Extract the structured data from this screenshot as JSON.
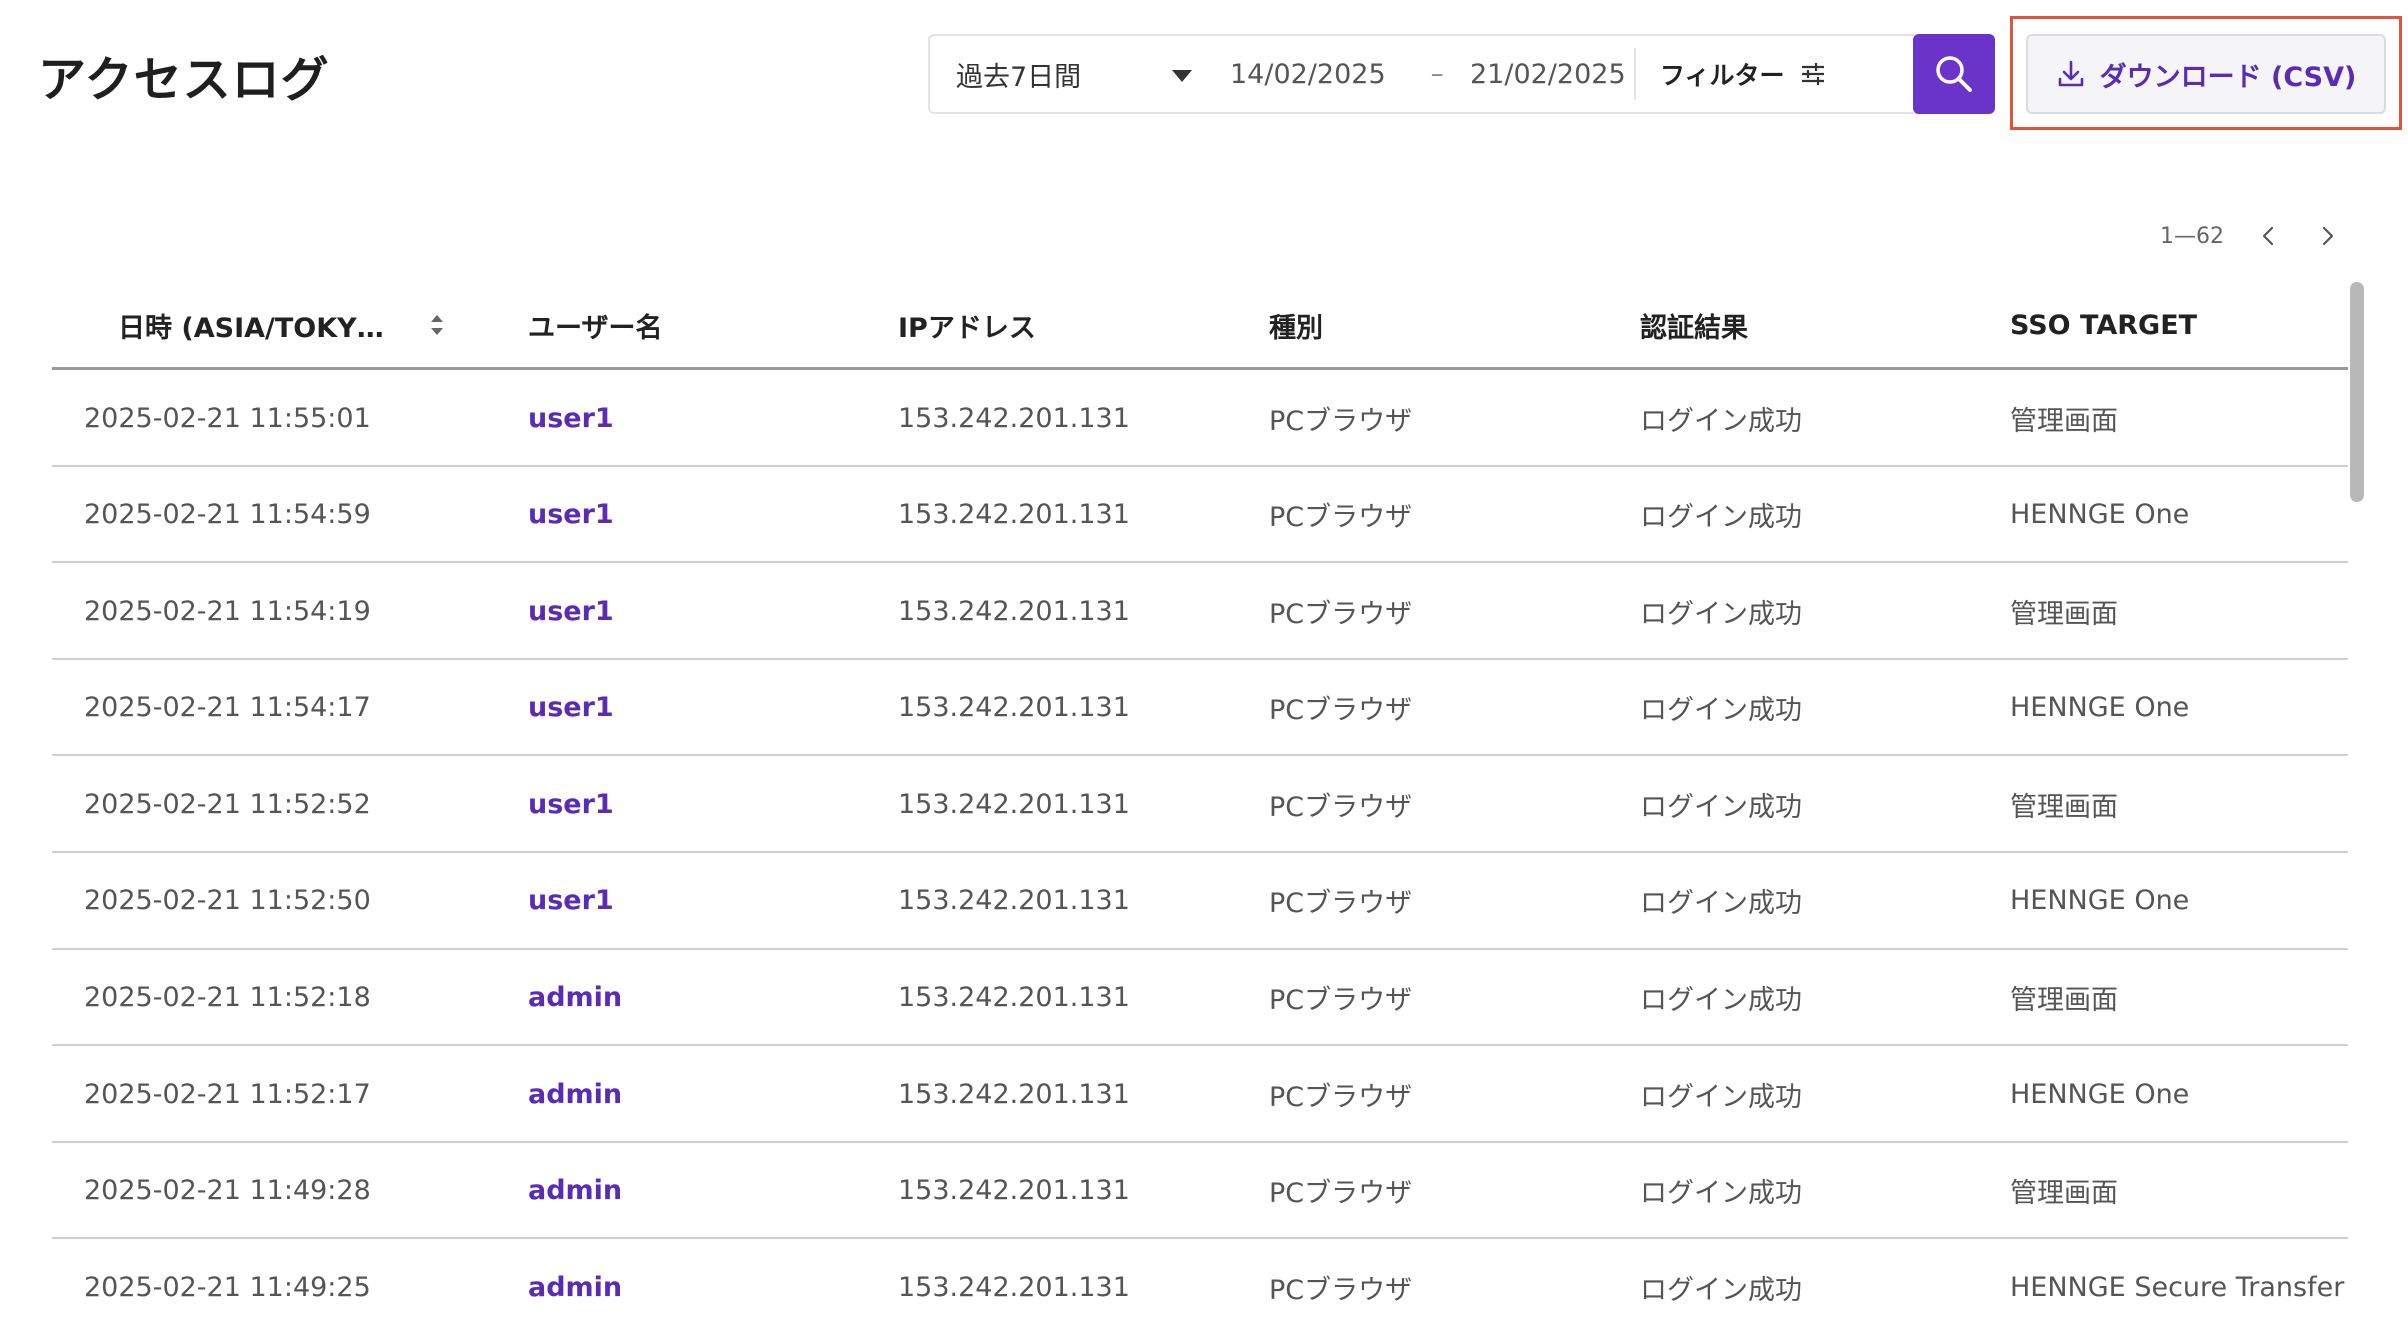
{
  "page": {
    "title": "アクセスログ"
  },
  "toolbar": {
    "period": "過去7日間",
    "date_from": "14/02/2025",
    "date_separator": "–",
    "date_to": "21/02/2025",
    "filter_label": "フィルター",
    "download_label": "ダウンロード (CSV)",
    "accent_color": "#6a33c9",
    "highlight_color": "#e0543c"
  },
  "pagination": {
    "range": "1—62"
  },
  "table": {
    "columns": [
      "日時 (ASIA/TOKY…",
      "ユーザー名",
      "IPアドレス",
      "種別",
      "認証結果",
      "SSO TARGET"
    ],
    "rows": [
      [
        "2025-02-21 11:55:01",
        "user1",
        "153.242.201.131",
        "PCブラウザ",
        "ログイン成功",
        "管理画面"
      ],
      [
        "2025-02-21 11:54:59",
        "user1",
        "153.242.201.131",
        "PCブラウザ",
        "ログイン成功",
        "HENNGE One"
      ],
      [
        "2025-02-21 11:54:19",
        "user1",
        "153.242.201.131",
        "PCブラウザ",
        "ログイン成功",
        "管理画面"
      ],
      [
        "2025-02-21 11:54:17",
        "user1",
        "153.242.201.131",
        "PCブラウザ",
        "ログイン成功",
        "HENNGE One"
      ],
      [
        "2025-02-21 11:52:52",
        "user1",
        "153.242.201.131",
        "PCブラウザ",
        "ログイン成功",
        "管理画面"
      ],
      [
        "2025-02-21 11:52:50",
        "user1",
        "153.242.201.131",
        "PCブラウザ",
        "ログイン成功",
        "HENNGE One"
      ],
      [
        "2025-02-21 11:52:18",
        "admin",
        "153.242.201.131",
        "PCブラウザ",
        "ログイン成功",
        "管理画面"
      ],
      [
        "2025-02-21 11:52:17",
        "admin",
        "153.242.201.131",
        "PCブラウザ",
        "ログイン成功",
        "HENNGE One"
      ],
      [
        "2025-02-21 11:49:28",
        "admin",
        "153.242.201.131",
        "PCブラウザ",
        "ログイン成功",
        "管理画面"
      ],
      [
        "2025-02-21 11:49:25",
        "admin",
        "153.242.201.131",
        "PCブラウザ",
        "ログイン成功",
        "HENNGE Secure Transfer ("
      ]
    ]
  },
  "icons": {
    "period_dropdown": "caret-down-icon",
    "filter": "sliders-icon",
    "search": "search-icon",
    "download": "download-icon",
    "sort": "sort-icon",
    "prev_page": "chevron-left-icon",
    "next_page": "chevron-right-icon"
  }
}
